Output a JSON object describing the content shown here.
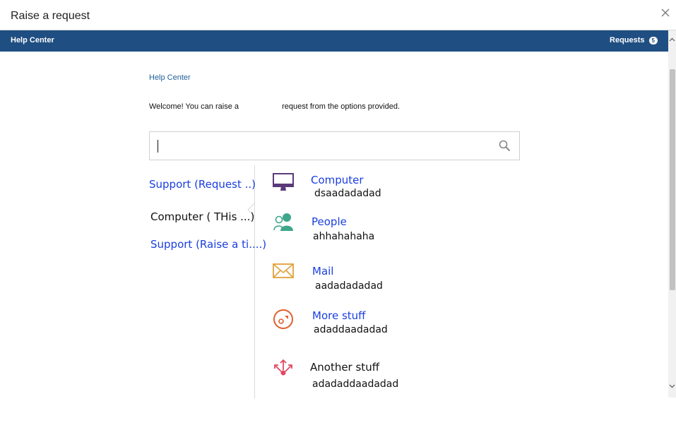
{
  "dialog": {
    "title": "Raise a request"
  },
  "topbar": {
    "title": "Help Center",
    "requests_label": "Requests",
    "requests_count": "5"
  },
  "breadcrumb": "Help Center",
  "welcome": "Welcome! You can raise a                    request from the options provided.",
  "search": {
    "value": "",
    "placeholder": ""
  },
  "categories": [
    {
      "label": "Support (Request ..)",
      "state": "link"
    },
    {
      "label": "Computer ( THis ...)",
      "state": "selected"
    },
    {
      "label": "Support (Raise a ti....)",
      "state": "link"
    }
  ],
  "items": [
    {
      "title": "Computer",
      "desc": "dsaadadadad",
      "icon": "computer-monitor-icon"
    },
    {
      "title": "People",
      "desc": "ahhahahaha",
      "icon": "people-icon"
    },
    {
      "title": "Mail",
      "desc": "aadadadadad",
      "icon": "mail-icon"
    },
    {
      "title": "More stuff",
      "desc": "adaddaadadad",
      "icon": "disc-icon"
    },
    {
      "title": "Another stuff",
      "desc": "adadaddaadadad",
      "icon": "share-arrows-icon"
    }
  ],
  "colors": {
    "topbar": "#1f4e82",
    "link": "#1a3ee0",
    "computer_icon": "#5b3a7a",
    "people_icon": "#3fa68c",
    "mail_icon": "#e0a13a",
    "disc_icon": "#e0602d",
    "share_icon": "#e04a63"
  }
}
